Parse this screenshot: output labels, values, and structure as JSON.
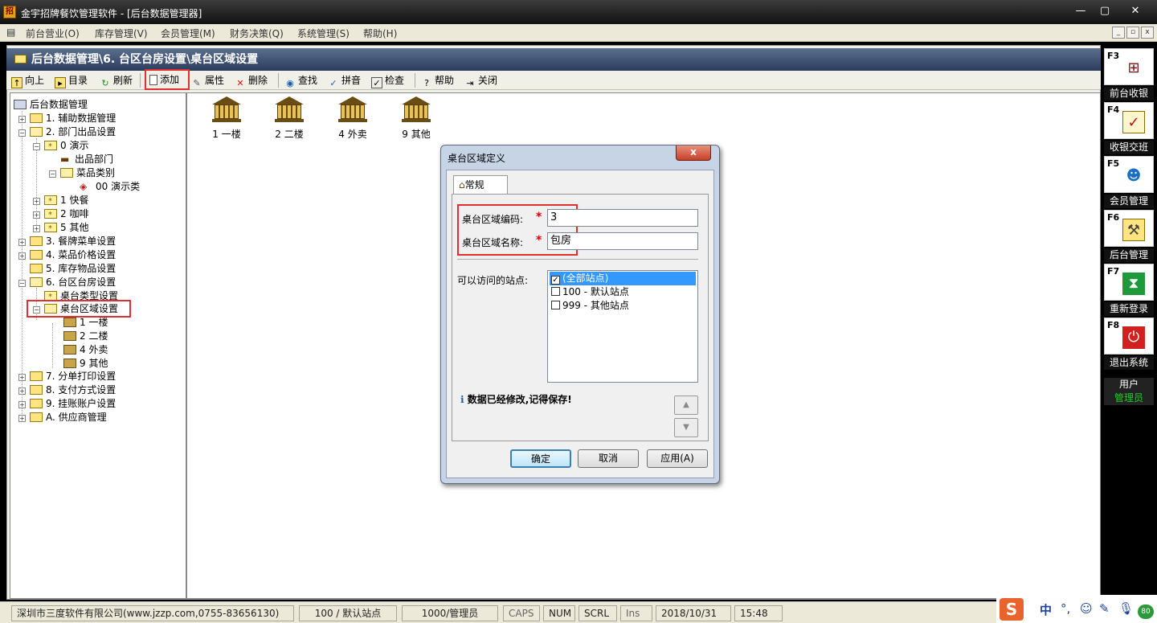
{
  "window": {
    "title": "金宇招牌餐饮管理软件 - [后台数据管理器]",
    "icon": "app-icon",
    "minimize": "—",
    "maximize": "▢",
    "close": "✕"
  },
  "menubar": {
    "items": [
      "前台营业(O)",
      "库存管理(V)",
      "会员管理(M)",
      "财务决策(Q)",
      "系统管理(S)",
      "帮助(H)"
    ]
  },
  "path": "后台数据管理\\6. 台区台房设置\\桌台区域设置",
  "toolbar": {
    "up": "向上",
    "dir": "目录",
    "refresh": "刷新",
    "add": "添加",
    "props": "属性",
    "delete": "删除",
    "find": "查找",
    "pinyin": "拼音",
    "check": "检查",
    "help": "帮助",
    "close": "关闭"
  },
  "tree": {
    "root": "后台数据管理",
    "n1": "1. 辅助数据管理",
    "n2": "2. 部门出品设置",
    "n2_0": "0 演示",
    "n2_0_a": "出品部门",
    "n2_0_b": "菜品类别",
    "n2_0_b_0": "00 演示类",
    "n2_1": "1 快餐",
    "n2_2": "2 咖啡",
    "n2_5": "5 其他",
    "n3": "3. 餐牌菜单设置",
    "n4": "4. 菜品价格设置",
    "n5": "5. 库存物品设置",
    "n6": "6. 台区台房设置",
    "n6_a": "桌台类型设置",
    "n6_b": "桌台区域设置",
    "n6_b_1": "1 一楼",
    "n6_b_2": "2 二楼",
    "n6_b_4": "4 外卖",
    "n6_b_9": "9 其他",
    "n7": "7. 分单打印设置",
    "n8": "8. 支付方式设置",
    "n9": "9. 挂账账户设置",
    "nA": "A. 供应商管理"
  },
  "zones": [
    "1 一楼",
    "2 二楼",
    "4 外卖",
    "9 其他"
  ],
  "dialog": {
    "title": "桌台区域定义",
    "tab": "常规",
    "code_label": "桌台区域编码:",
    "code_value": "3",
    "name_label": "桌台区域名称:",
    "name_value": "包房",
    "required_mark": "*",
    "sites_label": "可以访问的站点:",
    "sites": [
      {
        "label": "(全部站点)",
        "checked": true,
        "selected": true
      },
      {
        "label": "100 - 默认站点",
        "checked": false,
        "selected": false
      },
      {
        "label": "999 - 其他站点",
        "checked": false,
        "selected": false
      }
    ],
    "notice": "数据已经修改,记得保存!",
    "ok": "确定",
    "cancel": "取消",
    "apply": "应用(A)",
    "close": "x"
  },
  "dock": {
    "items": [
      {
        "key": "F3",
        "label": "前台收银",
        "icon": "cashier-table-icon"
      },
      {
        "key": "F4",
        "label": "收银交班",
        "icon": "clipboard-check-icon"
      },
      {
        "key": "F5",
        "label": "会员管理",
        "icon": "members-icon"
      },
      {
        "key": "F6",
        "label": "后台管理",
        "icon": "folder-tools-icon"
      },
      {
        "key": "F7",
        "label": "重新登录",
        "icon": "hourglass-icon"
      },
      {
        "key": "F8",
        "label": "退出系统",
        "icon": "power-icon"
      }
    ],
    "user_label": "用户",
    "user_name": "管理员"
  },
  "status": {
    "company": "深圳市三度软件有限公司(www.jzzp.com,0755-83656130)",
    "site": "100 / 默认站点",
    "user": "1000/管理员",
    "caps": "CAPS",
    "num": "NUM",
    "scrl": "SCRL",
    "ins": "Ins",
    "date": "2018/10/31",
    "time": "15:48"
  },
  "ime": {
    "logo": "S",
    "lang": "中",
    "punct": "°,",
    "emoji": "☺",
    "pen": "✎",
    "mic": "🎙",
    "badge": "80"
  },
  "colors": {
    "highlight_box": "#e03030",
    "selection": "#3399ff",
    "dock_label_bg": "#111111",
    "user_name": "#22cc22"
  }
}
